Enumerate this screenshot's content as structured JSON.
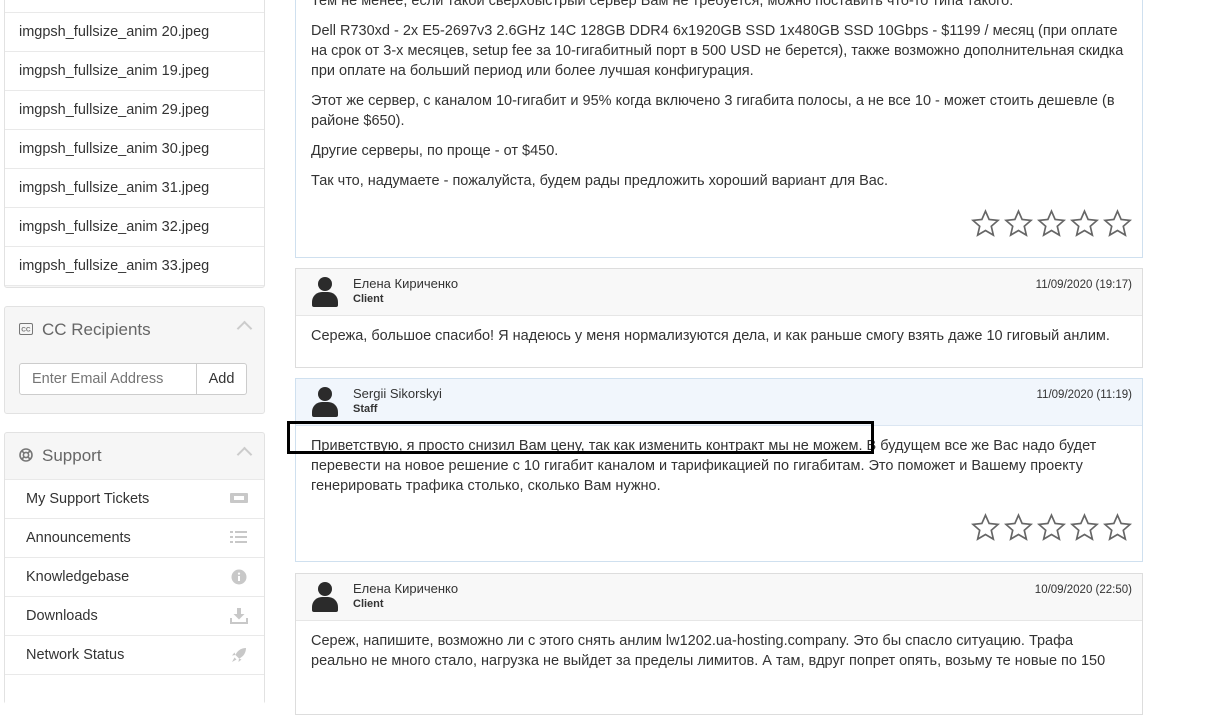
{
  "sidebar": {
    "files": [
      "imgpsh_fullsize_anim 20.jpeg",
      "imgpsh_fullsize_anim 19.jpeg",
      "imgpsh_fullsize_anim 29.jpeg",
      "imgpsh_fullsize_anim 30.jpeg",
      "imgpsh_fullsize_anim 31.jpeg",
      "imgpsh_fullsize_anim 32.jpeg",
      "imgpsh_fullsize_anim 33.jpeg"
    ],
    "cc": {
      "icon": "cc-icon",
      "title": "CC Recipients",
      "placeholder": "Enter Email Address",
      "add_label": "Add"
    },
    "support": {
      "icon": "lifebuoy-icon",
      "title": "Support",
      "items": [
        {
          "label": "My Support Tickets",
          "icon": "ticket-icon"
        },
        {
          "label": "Announcements",
          "icon": "list-icon"
        },
        {
          "label": "Knowledgebase",
          "icon": "info-icon"
        },
        {
          "label": "Downloads",
          "icon": "download-icon"
        },
        {
          "label": "Network Status",
          "icon": "rocket-icon"
        }
      ]
    }
  },
  "replies": [
    {
      "body": [
        "Тем не менее, если такой сверхбыстрый сервер Вам не требуется, можно поставить что-то типа такого:",
        "Dell R730xd - 2x E5-2697v3 2.6GHz 14C 128GB DDR4 6x1920GB SSD 1x480GB SSD 10Gbps - $1199 / месяц (при оплате на срок от 3-х месяцев, setup fee за 10-гигабитный порт в 500 USD не берется), также возможно дополнительная скидка при оплате на больший период или более лучшая конфигурация.",
        "Этот же сервер, с каналом 10-гигабит и 95% когда включено 3 гигабита полосы, а не все 10 - может стоить дешевле (в районе $650).",
        "Другие серверы, по проще - от $450.",
        "Так что, надумаете - пожалуйста, будем рады предложить хороший вариант для Вас."
      ],
      "rating": 0
    },
    {
      "name": "Елена Кириченко",
      "role": "Client",
      "date": "11/09/2020 (19:17)",
      "body": [
        "Сережа, большое спасибо! Я надеюсь у меня нормализуются дела, и как раньше смогу взять даже 10 гиговый анлим."
      ]
    },
    {
      "name": "Sergii Sikorskyi",
      "role": "Staff",
      "date": "11/09/2020 (11:19)",
      "body": [
        "Приветствую, я просто снизил Вам цену, так как изменить контракт мы не можем. В будущем все же Вас надо будет перевести на новое решение с 10 гигабит каналом и тарификацией по гигабитам. Это поможет и Вашему проекту генерировать трафика столько, сколько Вам нужно."
      ],
      "rating": 0
    },
    {
      "name": "Елена Кириченко",
      "role": "Client",
      "date": "10/09/2020 (22:50)",
      "body": [
        "Сереж, напишите, возможно ли с этого снять анлим lw1202.ua-hosting.company. Это бы спасло ситуацию. Трафа реально не много стало, нагрузка не выйдет за пределы лимитов. А там, вдруг попрет опять, возьму те новые по 150"
      ]
    }
  ]
}
